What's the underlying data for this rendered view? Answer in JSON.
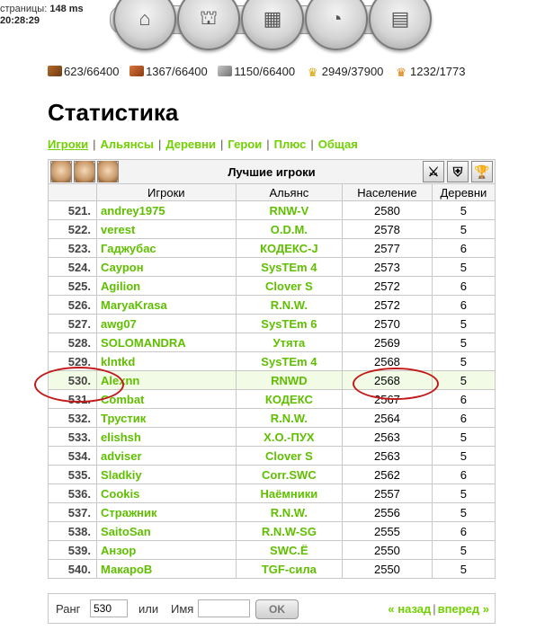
{
  "page_info": {
    "label": "страницы:",
    "time_ms": "148 ms",
    "clock": "20:28:29"
  },
  "resources": [
    {
      "icon": "wood-icon",
      "value": "623/66400"
    },
    {
      "icon": "clay-icon",
      "value": "1367/66400"
    },
    {
      "icon": "iron-icon",
      "value": "1150/66400"
    },
    {
      "icon": "crop-icon",
      "value": "2949/37900"
    },
    {
      "icon": "crop-consumption-icon",
      "value": "1232/1773"
    }
  ],
  "title": "Статистика",
  "tabs": [
    {
      "label": "Игроки",
      "active": true
    },
    {
      "label": "Альянсы"
    },
    {
      "label": "Деревни"
    },
    {
      "label": "Герои"
    },
    {
      "label": "Плюс"
    },
    {
      "label": "Общая"
    }
  ],
  "table": {
    "caption": "Лучшие игроки",
    "columns": [
      "Игроки",
      "Альянс",
      "Население",
      "Деревни"
    ],
    "rows": [
      {
        "rank": "521.",
        "name": "andrey1975",
        "ally": "RNW-V",
        "pop": "2580",
        "vil": "5"
      },
      {
        "rank": "522.",
        "name": "verest",
        "ally": "O.D.M.",
        "pop": "2578",
        "vil": "5"
      },
      {
        "rank": "523.",
        "name": "Гаджубас",
        "ally": "КОДЕКС-J",
        "pop": "2577",
        "vil": "6"
      },
      {
        "rank": "524.",
        "name": "Саурон",
        "ally": "SysTEm 4",
        "pop": "2573",
        "vil": "5"
      },
      {
        "rank": "525.",
        "name": "Agilion",
        "ally": "Clover S",
        "pop": "2572",
        "vil": "6"
      },
      {
        "rank": "526.",
        "name": "MaryaKrasa",
        "ally": "R.N.W.",
        "pop": "2572",
        "vil": "6"
      },
      {
        "rank": "527.",
        "name": "awg07",
        "ally": "SysTEm 6",
        "pop": "2570",
        "vil": "5"
      },
      {
        "rank": "528.",
        "name": "SOLOMANDRA",
        "ally": "Утята",
        "pop": "2569",
        "vil": "5"
      },
      {
        "rank": "529.",
        "name": "klntkd",
        "ally": "SysTEm 4",
        "pop": "2568",
        "vil": "5"
      },
      {
        "rank": "530.",
        "name": "Alexnn",
        "ally": "RNWD",
        "pop": "2568",
        "vil": "5",
        "highlight": true
      },
      {
        "rank": "531.",
        "name": "Combat",
        "ally": "КОДЕКС",
        "pop": "2567",
        "vil": "6"
      },
      {
        "rank": "532.",
        "name": "Трустик",
        "ally": "R.N.W.",
        "pop": "2564",
        "vil": "6"
      },
      {
        "rank": "533.",
        "name": "elishsh",
        "ally": "Х.О.-ПУХ",
        "pop": "2563",
        "vil": "5"
      },
      {
        "rank": "534.",
        "name": "adviser",
        "ally": "Clover S",
        "pop": "2563",
        "vil": "5"
      },
      {
        "rank": "535.",
        "name": "Sladkiy",
        "ally": "Corr.SWC",
        "pop": "2562",
        "vil": "6"
      },
      {
        "rank": "536.",
        "name": "Cookis",
        "ally": "Наёмники",
        "pop": "2557",
        "vil": "5"
      },
      {
        "rank": "537.",
        "name": "Стражник",
        "ally": "R.N.W.",
        "pop": "2556",
        "vil": "5"
      },
      {
        "rank": "538.",
        "name": "SaitoSan",
        "ally": "R.N.W-SG",
        "pop": "2555",
        "vil": "6"
      },
      {
        "rank": "539.",
        "name": "Анзор",
        "ally": "SWC.Ё",
        "pop": "2550",
        "vil": "5"
      },
      {
        "rank": "540.",
        "name": "МакароВ",
        "ally": "TGF-сила",
        "pop": "2550",
        "vil": "5"
      }
    ]
  },
  "search": {
    "rank_label": "Ранг",
    "rank_value": "530",
    "or_label": "или",
    "name_label": "Имя",
    "name_value": "",
    "ok_label": "OK",
    "prev_label": "« назад",
    "next_label": "вперед »"
  },
  "colors": {
    "link_green": "#71d000",
    "highlight_bg": "#f2fbe6",
    "annotation_red": "#c21a1a"
  }
}
